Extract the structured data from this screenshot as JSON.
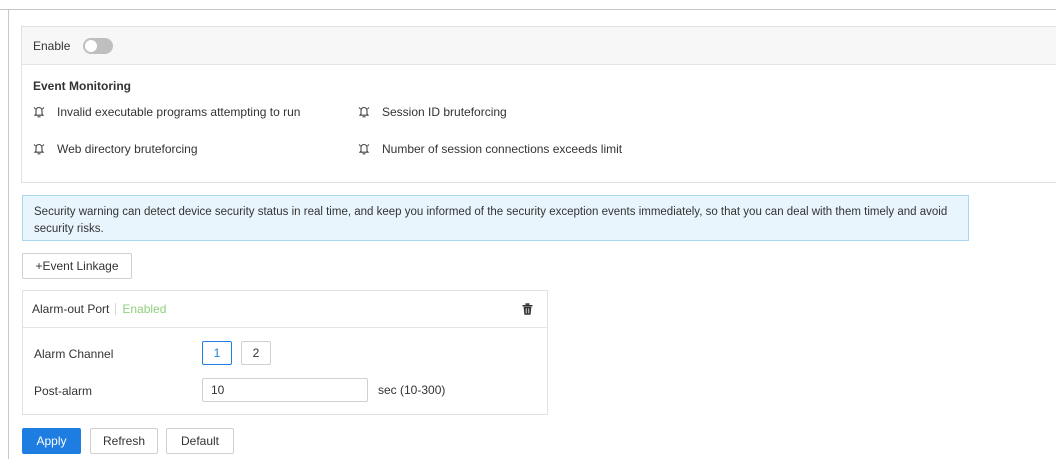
{
  "enable": {
    "label": "Enable",
    "on": false
  },
  "monitoring": {
    "title": "Event Monitoring",
    "events": [
      "Invalid executable programs attempting to run",
      "Session ID bruteforcing",
      "Web directory bruteforcing",
      "Number of session connections exceeds limit"
    ],
    "event_icon": "alarm-bell-icon"
  },
  "notice": {
    "text": "Security warning can detect device security status in real time, and keep you informed of the security exception events immediately, so that you can deal with them timely and avoid security risks."
  },
  "linkage": {
    "add_label": "+Event Linkage",
    "card": {
      "title": "Alarm-out Port",
      "status": "Enabled",
      "delete_icon": "trash-icon",
      "channel_label": "Alarm Channel",
      "channels": [
        "1",
        "2"
      ],
      "selected_channel": "1",
      "post_alarm_label": "Post-alarm",
      "post_alarm_value": "10",
      "post_alarm_unit": "sec (10-300)"
    }
  },
  "actions": {
    "apply": "Apply",
    "refresh": "Refresh",
    "default": "Default"
  },
  "colors": {
    "primary": "#1d7de1",
    "enabled_text": "#8fd07c",
    "notice_bg": "#e9f5fc",
    "notice_border": "#a8d8f2"
  }
}
